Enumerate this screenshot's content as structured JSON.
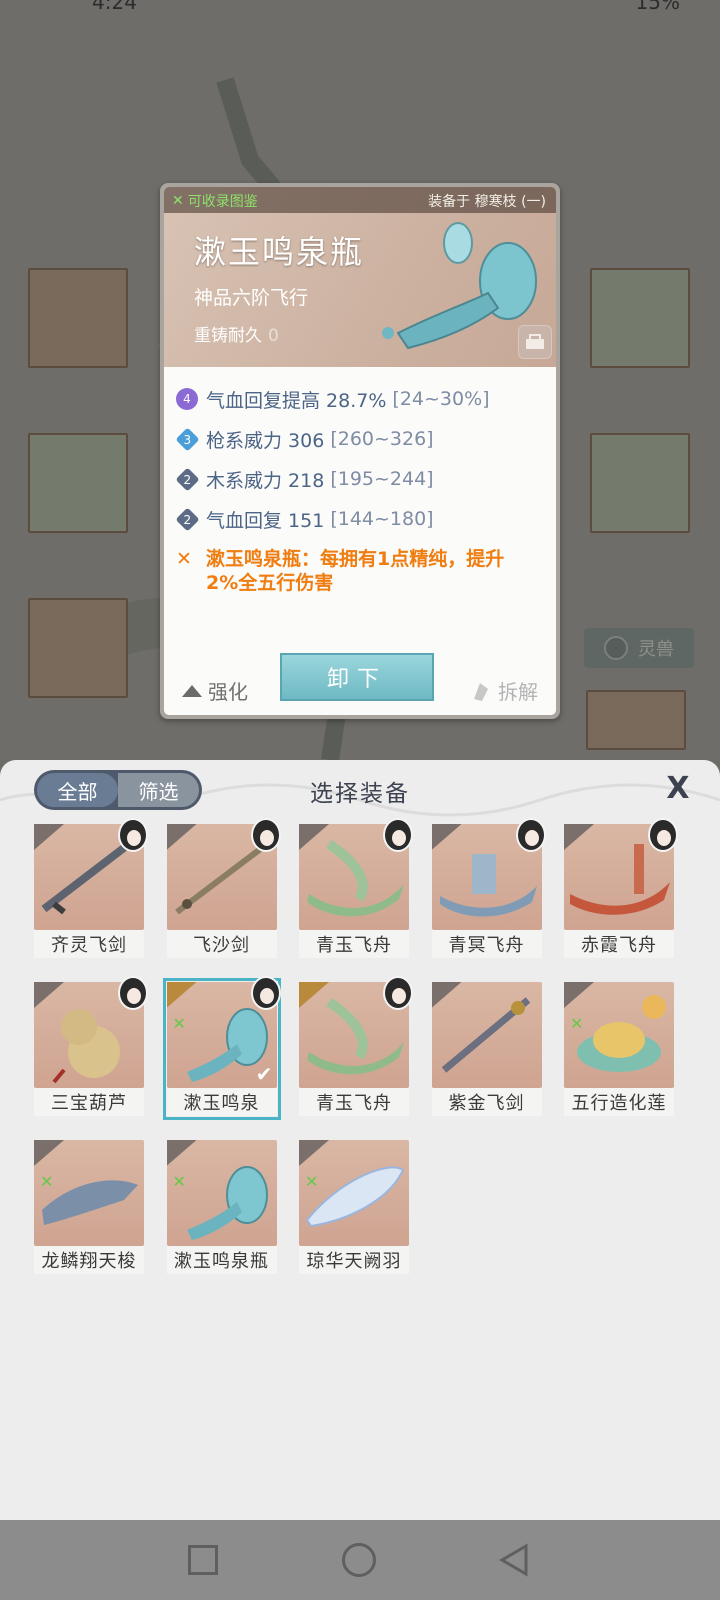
{
  "status": {
    "time": "4:24",
    "battery": "15%"
  },
  "background": {
    "pet_button_label": "灵兽"
  },
  "detail": {
    "collect_label": "可收录图鉴",
    "equipped_by": "装备于 穆寒枝 (一)",
    "name": "漱玉鸣泉瓶",
    "grade": "神品六阶飞行",
    "durability_label": "重铸耐久",
    "durability_value": "0",
    "stats": [
      {
        "tier": "4",
        "name": "气血回复提高 28.7%",
        "range": "[24~30%]",
        "badge": "purple"
      },
      {
        "tier": "3",
        "name": "枪系威力 306",
        "range": "[260~326]",
        "badge": "blue"
      },
      {
        "tier": "2",
        "name": "木系威力 218",
        "range": "[195~244]",
        "badge": "gray"
      },
      {
        "tier": "2",
        "name": "气血回复 151",
        "range": "[144~180]",
        "badge": "gray"
      }
    ],
    "special_line1": "漱玉鸣泉瓶：每拥有1点精纯，提升",
    "special_line2": "2%全五行伤害",
    "actions": {
      "strengthen": "强化",
      "unequip": "卸下",
      "dismantle": "拆解"
    }
  },
  "sheet": {
    "title": "选择装备",
    "tabs": [
      "全部",
      "筛选"
    ],
    "close": "X",
    "items": [
      {
        "name": "齐灵飞剑",
        "avatar": true,
        "wing": "gray",
        "art": "sword"
      },
      {
        "name": "飞沙剑",
        "avatar": true,
        "wing": "gray",
        "art": "sword2"
      },
      {
        "name": "青玉飞舟",
        "avatar": true,
        "wing": "gray",
        "art": "boat-green"
      },
      {
        "name": "青冥飞舟",
        "avatar": true,
        "wing": "gray",
        "art": "boat-blue"
      },
      {
        "name": "赤霞飞舟",
        "avatar": true,
        "wing": "gray",
        "art": "boat-red"
      },
      {
        "name": "三宝葫芦",
        "avatar": true,
        "wing": "gray",
        "art": "gourd"
      },
      {
        "name": "漱玉鸣泉",
        "avatar": true,
        "wing": "gold",
        "art": "bottle",
        "selected": true,
        "green": true
      },
      {
        "name": "青玉飞舟",
        "avatar": true,
        "wing": "gold",
        "art": "boat-green"
      },
      {
        "name": "紫金飞剑",
        "avatar": false,
        "wing": "gray",
        "art": "sword3"
      },
      {
        "name": "五行造化莲",
        "avatar": false,
        "wing": "gray",
        "art": "lotus",
        "green": true
      },
      {
        "name": "龙鳞翔天梭",
        "avatar": false,
        "wing": "gray",
        "art": "shuttle",
        "green": true
      },
      {
        "name": "漱玉鸣泉瓶",
        "avatar": false,
        "wing": "gray",
        "art": "bottle",
        "green": true
      },
      {
        "name": "琼华天阙羽",
        "avatar": false,
        "wing": "gray",
        "art": "feather",
        "green": true
      }
    ]
  },
  "navbar": {
    "buttons": [
      "recent-apps",
      "home",
      "back"
    ]
  },
  "colors": {
    "accent_teal": "#6fb9c4",
    "special_orange": "#f07d10",
    "stat_blue": "#4c6486"
  }
}
